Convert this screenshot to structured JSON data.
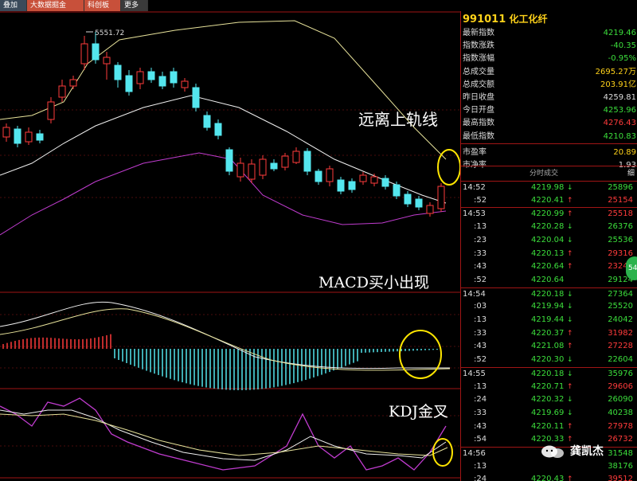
{
  "toolbar": {
    "items": [
      "叠加",
      "大数据掘金",
      "科创板",
      "更多"
    ]
  },
  "annotations": {
    "upper_band": "远离上轨线",
    "macd": "MACD买小出现",
    "kdj": "KDJ金叉"
  },
  "chart": {
    "peak_label": "5551.72"
  },
  "quote": {
    "code": "991011",
    "name": "化工化纤",
    "rows": [
      {
        "label": "最新指数",
        "value": "4219.46",
        "color": "#3cdf3c"
      },
      {
        "label": "指数涨跌",
        "value": "-40.35",
        "color": "#3cdf3c"
      },
      {
        "label": "指数涨幅",
        "value": "-0.95%",
        "color": "#3cdf3c"
      },
      {
        "label": "总成交量",
        "value": "2695.27万",
        "color": "#ffd21a"
      },
      {
        "label": "总成交额",
        "value": "203.91亿",
        "color": "#ffd21a"
      },
      {
        "label": "昨日收盘",
        "value": "4259.81",
        "color": "#dddddd"
      },
      {
        "label": "今日开盘",
        "value": "4253.96",
        "color": "#3cdf3c"
      },
      {
        "label": "最高指数",
        "value": "4276.43",
        "color": "#ff3b3b"
      },
      {
        "label": "最低指数",
        "value": "4210.83",
        "color": "#3cdf3c"
      },
      {
        "label": "市盈率",
        "value": "20.89",
        "color": "#ffd21a"
      },
      {
        "label": "市净率",
        "value": "1.93",
        "color": "#dddddd"
      }
    ]
  },
  "ticks_header": {
    "title": "分时成交",
    "tab": "细"
  },
  "ticks": [
    {
      "time": "14:52",
      "price": "4219.98",
      "dir": "down",
      "vol": "25896"
    },
    {
      "time": ":52",
      "price": "4220.41",
      "dir": "up",
      "vol": "25154"
    },
    {
      "time": "14:53",
      "price": "4220.99",
      "dir": "up",
      "vol": "25518"
    },
    {
      "time": ":13",
      "price": "4220.28",
      "dir": "down",
      "vol": "26376"
    },
    {
      "time": ":23",
      "price": "4220.04",
      "dir": "down",
      "vol": "25536"
    },
    {
      "time": ":33",
      "price": "4220.13",
      "dir": "up",
      "vol": "29316"
    },
    {
      "time": ":43",
      "price": "4220.64",
      "dir": "up",
      "vol": "23248"
    },
    {
      "time": ":52",
      "price": "4220.64",
      "dir": "",
      "vol": "29124"
    },
    {
      "time": "14:54",
      "price": "4220.18",
      "dir": "down",
      "vol": "27364"
    },
    {
      "time": ":03",
      "price": "4219.94",
      "dir": "down",
      "vol": "25520"
    },
    {
      "time": ":13",
      "price": "4219.44",
      "dir": "down",
      "vol": "24042"
    },
    {
      "time": ":33",
      "price": "4220.37",
      "dir": "up",
      "vol": "31982"
    },
    {
      "time": ":43",
      "price": "4221.08",
      "dir": "up",
      "vol": "27228"
    },
    {
      "time": ":52",
      "price": "4220.30",
      "dir": "down",
      "vol": "22604"
    },
    {
      "time": "14:55",
      "price": "4220.18",
      "dir": "down",
      "vol": "35976"
    },
    {
      "time": ":13",
      "price": "4220.71",
      "dir": "up",
      "vol": "29606"
    },
    {
      "time": ":24",
      "price": "4220.32",
      "dir": "down",
      "vol": "26090"
    },
    {
      "time": ":33",
      "price": "4219.69",
      "dir": "down",
      "vol": "40238"
    },
    {
      "time": ":43",
      "price": "4220.11",
      "dir": "up",
      "vol": "27978"
    },
    {
      "time": ":54",
      "price": "4220.33",
      "dir": "up",
      "vol": "26732"
    },
    {
      "time": "14:56",
      "price": "",
      "dir": "",
      "vol": "31548"
    },
    {
      "time": ":13",
      "price": "",
      "dir": "",
      "vol": "38176"
    },
    {
      "time": ":24",
      "price": "4220.43",
      "dir": "up",
      "vol": "39512"
    }
  ],
  "side_badge": "54",
  "watermark": "龚凯杰",
  "colors": {
    "up": "#ff3b3b",
    "down": "#3cdf3c",
    "candle_down": "#54e6ee",
    "band_upper": "#e7e29a",
    "band_lower": "#c03ccf",
    "grid": "#a01515",
    "highlight": "#ffe600"
  }
}
